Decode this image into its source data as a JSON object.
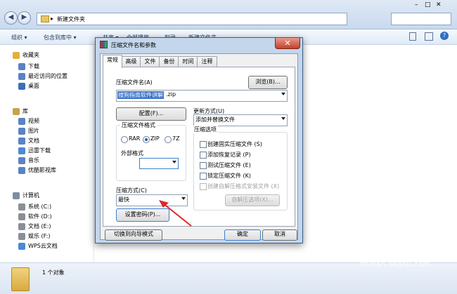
{
  "explorer": {
    "address": "新建文件夹",
    "commands": [
      "组织 ▾",
      "包含到库中 ▾",
      "共享 ▾",
      "全部播放",
      "刻录",
      "新建文件夹"
    ],
    "nav": [
      {
        "label": "收藏夹",
        "indent": 0,
        "color": "#e2b13c"
      },
      {
        "label": "下载",
        "indent": 1,
        "color": "#5b82c4"
      },
      {
        "label": "最近访问的位置",
        "indent": 1,
        "color": "#5b82c4"
      },
      {
        "label": "桌面",
        "indent": 1,
        "color": "#3d6cb9"
      },
      {
        "label": "",
        "indent": 0,
        "color": ""
      },
      {
        "label": "库",
        "indent": 0,
        "color": "#c9a24b"
      },
      {
        "label": "视频",
        "indent": 1,
        "color": "#5b82c4"
      },
      {
        "label": "图片",
        "indent": 1,
        "color": "#5b82c4"
      },
      {
        "label": "文档",
        "indent": 1,
        "color": "#5b82c4"
      },
      {
        "label": "迅雷下载",
        "indent": 1,
        "color": "#4c89d6"
      },
      {
        "label": "音乐",
        "indent": 1,
        "color": "#5b82c4"
      },
      {
        "label": "优酷影视库",
        "indent": 1,
        "color": "#5b82c4"
      },
      {
        "label": "",
        "indent": 0,
        "color": ""
      },
      {
        "label": "计算机",
        "indent": 0,
        "color": "#7d8da3"
      },
      {
        "label": "系统 (C:)",
        "indent": 1,
        "color": "#8a8f96"
      },
      {
        "label": "软件 (D:)",
        "indent": 1,
        "color": "#8a8f96"
      },
      {
        "label": "文档 (E:)",
        "indent": 1,
        "color": "#8a8f96"
      },
      {
        "label": "娱乐 (F:)",
        "indent": 1,
        "color": "#8a8f96"
      },
      {
        "label": "WPS云文档",
        "indent": 1,
        "color": "#4c89d6"
      }
    ],
    "status": "1 个对象"
  },
  "dialog": {
    "title": "压缩文件名和参数",
    "tabs": [
      "常规",
      "高级",
      "文件",
      "备份",
      "时间",
      "注释"
    ],
    "archive_name_label": "压缩文件名(A)",
    "archive_name_selected": "搜狗指南软件讲解",
    "archive_name_ext": ".zip",
    "browse_button": "浏览(B)...",
    "config_button": "配置(F)...",
    "update_mode_label": "更新方式(U)",
    "update_mode_value": "添加并替换文件",
    "format_group": "压缩文件格式",
    "formats": [
      {
        "label": "RAR",
        "selected": false
      },
      {
        "label": "ZIP",
        "selected": true
      },
      {
        "label": "7Z",
        "selected": false
      }
    ],
    "external_format_label": "外部格式",
    "compress_method_label": "压缩方式(C)",
    "compress_method_value": "最快",
    "set_password_button": "设置密码(P)...",
    "options_group": "压缩选项",
    "options": [
      {
        "label": "创建固实压缩文件 (S)",
        "enabled": true
      },
      {
        "label": "添加恢复记录 (P)",
        "enabled": true
      },
      {
        "label": "测试压缩文件 (E)",
        "enabled": true
      },
      {
        "label": "锁定压缩文件 (K)",
        "enabled": true
      },
      {
        "label": "创建自解压格式安装文件 (X)",
        "enabled": false
      }
    ],
    "sfx_options_button": "自解压选项(X)...",
    "wizard_button": "切换到向导模式",
    "ok_button": "确定",
    "cancel_button": "取消"
  },
  "watermark": {
    "text": "搜狗指南",
    "url": "zhinan.sogou.com"
  }
}
